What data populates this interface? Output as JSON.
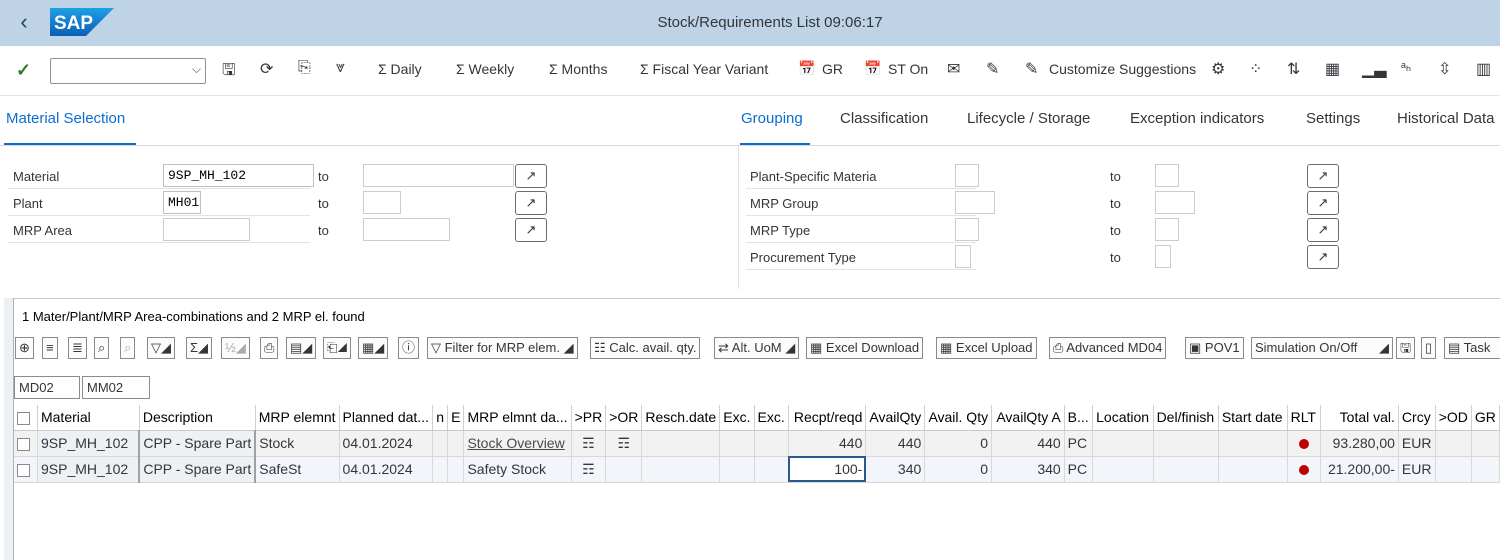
{
  "window": {
    "title": "Stock/Requirements List 09:06:17",
    "brand": "SAP"
  },
  "toolbar": {
    "combo_value": "",
    "daily": "Σ  Daily",
    "weekly": "Σ  Weekly",
    "months": "Σ  Months",
    "fyv": "Σ  Fiscal Year Variant",
    "gr": "GR",
    "st_on": "ST On",
    "customize": "Customize Suggestions"
  },
  "tabs_left": {
    "material_selection": "Material Selection"
  },
  "tabs_right": {
    "grouping": "Grouping",
    "classification": "Classification",
    "lifecycle": "Lifecycle / Storage",
    "exception": "Exception indicators",
    "settings": "Settings",
    "historical": "Historical Data"
  },
  "form_left": {
    "material_label": "Material",
    "material_value": "9SP_MH_102",
    "plant_label": "Plant",
    "plant_value": "MH01",
    "mrp_area_label": "MRP Area",
    "mrp_area_value": "",
    "to": "to"
  },
  "form_right": {
    "plant_specific_label": "Plant-Specific Materia",
    "mrp_group_label": "MRP Group",
    "mrp_type_label": "MRP Type",
    "procurement_label": "Procurement Type",
    "to": "to"
  },
  "grid": {
    "status": "1 Mater/Plant/MRP Area-combinations and 2 MRP el. found",
    "buttons": {
      "filter": "Filter for MRP elem.",
      "calc": "Calc. avail. qty.",
      "alt_uom": "Alt. UoM",
      "excel_download": "Excel Download",
      "excel_upload": "Excel Upload",
      "advanced": "Advanced MD04",
      "pov1": "POV1",
      "simulation": "Simulation On/Off",
      "task": "Task"
    },
    "filters": [
      "MD02",
      "MM02"
    ],
    "headers": [
      "Material",
      "Description",
      "MRP elemnt",
      "Planned dat...",
      "n",
      "E",
      "MRP elmnt da...",
      ">PR",
      ">OR",
      "Resch.date",
      "Exc.",
      "Exc.",
      "Recpt/reqd",
      "AvailQty",
      "Avail. Qty",
      "AvailQty A",
      "B...",
      "Location",
      "Del/finish",
      "Start date",
      "RLT",
      "Total val.",
      "Crcy",
      ">OD",
      "GR"
    ],
    "rows": [
      {
        "material": "9SP_MH_102",
        "description": "CPP - Spare Part",
        "mrp_element": "Stock",
        "planned_date": "04.01.2024",
        "mrp_element_data": "Stock Overview",
        "recpt_reqd": "440",
        "avail_qty": "440",
        "avail_qty2": "0",
        "avail_qty_a": "440",
        "bun": "PC",
        "total_val": "93.280,00",
        "crcy": "EUR"
      },
      {
        "material": "9SP_MH_102",
        "description": "CPP - Spare Part",
        "mrp_element": "SafeSt",
        "planned_date": "04.01.2024",
        "mrp_element_data": "Safety Stock",
        "recpt_reqd": "100-",
        "avail_qty": "340",
        "avail_qty2": "0",
        "avail_qty_a": "340",
        "bun": "PC",
        "total_val": "21.200,00-",
        "crcy": "EUR"
      }
    ]
  }
}
